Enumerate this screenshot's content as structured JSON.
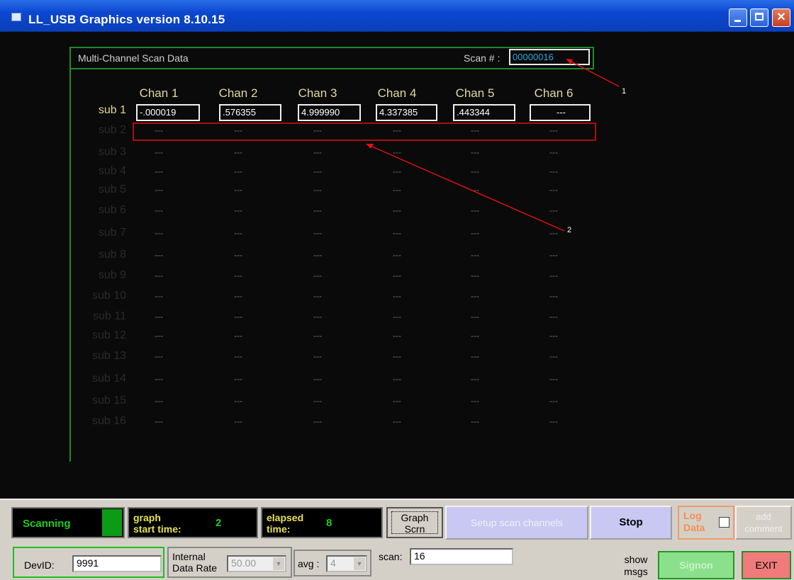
{
  "window": {
    "title": "LL_USB Graphics  version 8.10.15"
  },
  "panel": {
    "title": "Multi-Channel  Scan Data",
    "scan_label": "Scan # :",
    "scan_value": "00000016"
  },
  "channels": [
    "Chan 1",
    "Chan 2",
    "Chan 3",
    "Chan 4",
    "Chan 5",
    "Chan 6"
  ],
  "subs": [
    "sub 1",
    "sub 2",
    "sub 3",
    "sub 4",
    "sub 5",
    "sub 6",
    "sub 7",
    "sub 8",
    "sub 9",
    "sub 10",
    "sub 11",
    "sub 12",
    "sub 13",
    "sub 14",
    "sub 15",
    "sub 16"
  ],
  "sub1_values": [
    "-.000019",
    ".576355",
    "4.999990",
    "4.337385",
    ".443344",
    "---"
  ],
  "empty_value": "---",
  "annotations": {
    "one": "1",
    "two": "2"
  },
  "colors": {
    "annotation_red": "#e01010",
    "panel_green": "#1f8a2a",
    "scan_value": "#27a7e0"
  },
  "status": {
    "scanning_label": "Scanning",
    "graph_start_label": "graph\nstart time:",
    "graph_start_value": "2",
    "elapsed_label": "elapsed\ntime:",
    "elapsed_value": "8"
  },
  "buttons": {
    "graph_scrn": "Graph\nScrn",
    "setup_scan": "Setup scan channels",
    "stop": "Stop",
    "log_data": "Log\nData",
    "add_comment": "add\ncomment",
    "show_msgs": "show\nmsgs",
    "signon": "Signon",
    "exit": "EXIT"
  },
  "fields": {
    "devid_label": "DevID:",
    "devid_value": "9991",
    "rate_label": "Internal\nData Rate",
    "rate_value": "50.00",
    "avg_label": "avg :",
    "avg_value": "4",
    "scan_label": "scan:",
    "scan_value": "16"
  }
}
